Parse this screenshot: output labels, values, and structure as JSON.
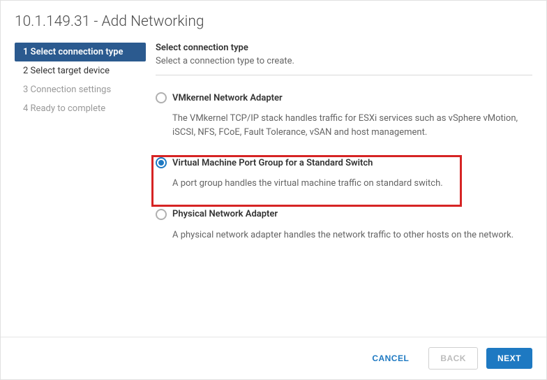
{
  "title": "10.1.149.31 - Add Networking",
  "steps": [
    {
      "num": "1",
      "label": "Select connection type"
    },
    {
      "num": "2",
      "label": "Select target device"
    },
    {
      "num": "3",
      "label": "Connection settings"
    },
    {
      "num": "4",
      "label": "Ready to complete"
    }
  ],
  "main": {
    "heading": "Select connection type",
    "subheading": "Select a connection type to create."
  },
  "options": [
    {
      "label": "VMkernel Network Adapter",
      "desc": "The VMkernel TCP/IP stack handles traffic for ESXi services such as vSphere vMotion, iSCSI, NFS, FCoE, Fault Tolerance, vSAN and host management."
    },
    {
      "label": "Virtual Machine Port Group for a Standard Switch",
      "desc": "A port group handles the virtual machine traffic on standard switch."
    },
    {
      "label": "Physical Network Adapter",
      "desc": "A physical network adapter handles the network traffic to other hosts on the network."
    }
  ],
  "buttons": {
    "cancel": "CANCEL",
    "back": "BACK",
    "next": "NEXT"
  }
}
